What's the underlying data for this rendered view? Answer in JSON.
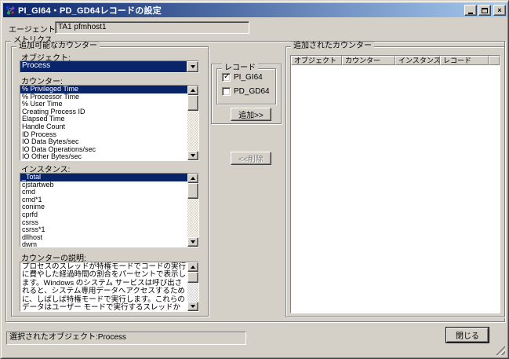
{
  "window": {
    "title": "PI_GI64・PD_GD64レコードの設定"
  },
  "agent": {
    "label": "エージェント名:",
    "value": "TA1 pfmhost1"
  },
  "metrics": {
    "label": "メトリクス"
  },
  "available": {
    "label": "追加可能なカウンター",
    "object": {
      "label": "オブジェクト:",
      "value": "Process"
    },
    "counter": {
      "label": "カウンター:",
      "selected": "% Privileged Time",
      "items": [
        "% Privileged Time",
        "% Processor Time",
        "% User Time",
        "Creating Process ID",
        "Elapsed Time",
        "Handle Count",
        "ID Process",
        "IO Data Bytes/sec",
        "IO Data Operations/sec",
        "IO Other Bytes/sec"
      ]
    },
    "instance": {
      "label": "インスタンス:",
      "selected": "_Total",
      "items": [
        "_Total",
        "cjstartweb",
        "cmd",
        "cmd*1",
        "conime",
        "cprfd",
        "csrss",
        "csrss*1",
        "dllhost",
        "dwm"
      ]
    },
    "description": {
      "label": "カウンターの説明:",
      "text": "プロセスのスレッドが特権モードでコードの実行に費やした経過時間の割合をパーセントで表示します。Windows のシステム サービスは呼び出されると、システム専用データへアクセスするために、しばしば特権モードで実行します。これらのデータはユーザー モードで実行するスレッドからはアクセスされません。システムの呼び出しは明示的に、または"
    }
  },
  "record": {
    "label": "レコード",
    "options": [
      {
        "label": "PI_GI64",
        "checked": true
      },
      {
        "label": "PD_GD64",
        "checked": false
      }
    ]
  },
  "buttons": {
    "add": "追加>>",
    "remove": "<<削除",
    "close": "閉じる"
  },
  "added": {
    "label": "追加されたカウンター",
    "columns": [
      "オブジェクト",
      "カウンター",
      "インスタンス",
      "レコード",
      ""
    ],
    "rows": []
  },
  "status": {
    "text": "選択されたオブジェクト:Process"
  },
  "colors": {
    "titlebar_start": "#0a246a",
    "titlebar_end": "#a6caf0",
    "selection": "#0a246a",
    "face": "#d4d0c8"
  }
}
